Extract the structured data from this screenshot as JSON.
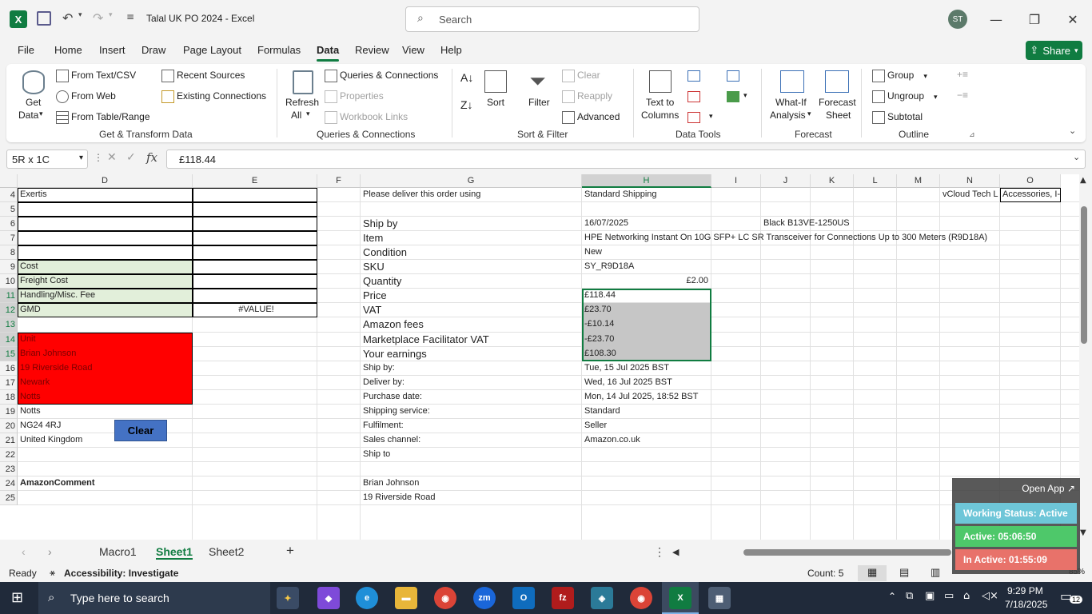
{
  "window": {
    "title": "Talal UK PO 2024  -  Excel",
    "search_placeholder": "Search",
    "user_initials": "ST"
  },
  "menu": [
    "File",
    "Home",
    "Insert",
    "Draw",
    "Page Layout",
    "Formulas",
    "Data",
    "Review",
    "View",
    "Help"
  ],
  "share_label": "Share",
  "ribbon": {
    "get_data": "Get",
    "get_data2": "Data",
    "from_text": "From Text/CSV",
    "from_web": "From Web",
    "from_table": "From Table/Range",
    "recent_sources": "Recent Sources",
    "existing_connections": "Existing Connections",
    "refresh": "Refresh",
    "refresh2": "All",
    "queries_connections": "Queries & Connections",
    "properties": "Properties",
    "workbook_links": "Workbook Links",
    "sort": "Sort",
    "filter": "Filter",
    "clear": "Clear",
    "reapply": "Reapply",
    "advanced": "Advanced",
    "text_to_columns": "Text to",
    "text_to_columns2": "Columns",
    "what_if": "What-If",
    "what_if2": "Analysis",
    "forecast_sheet": "Forecast",
    "forecast_sheet2": "Sheet",
    "group": "Group",
    "ungroup": "Ungroup",
    "subtotal": "Subtotal",
    "groups": {
      "get_transform": "Get & Transform Data",
      "queries": "Queries & Connections",
      "sort_filter": "Sort & Filter",
      "data_tools": "Data Tools",
      "forecast": "Forecast",
      "outline": "Outline"
    }
  },
  "name_box": "5R x 1C",
  "formula": "£118.44",
  "columns": [
    "D",
    "E",
    "F",
    "G",
    "H",
    "I",
    "J",
    "K",
    "L",
    "M",
    "N",
    "O"
  ],
  "rows": [
    "4",
    "5",
    "6",
    "7",
    "8",
    "9",
    "10",
    "11",
    "12",
    "13",
    "14",
    "15",
    "16",
    "17",
    "18",
    "19",
    "20",
    "21",
    "22",
    "23",
    "24",
    "25"
  ],
  "cells": {
    "D4": "Exertis",
    "D9": "Cost",
    "D10": "Freight Cost",
    "D11": "Handling/Misc. Fee",
    "D12": "GMD",
    "E12": "#VALUE!",
    "D14": "Unit",
    "D15": "Brian Johnson",
    "D16": "19 Riverside Road",
    "D17": "Newark",
    "D18": "Notts",
    "D19": "Notts",
    "D20": "NG24 4RJ",
    "D21": "United Kingdom",
    "D24": "AmazonComment",
    "G4": "Please deliver this order using",
    "H4": "Standard Shipping",
    "N4": "vCloud Tech L",
    "O4": "Accessories, I-",
    "G6": "Ship by",
    "H6": "16/07/2025",
    "J6": "Black B13VE-1250US",
    "G7": "Item",
    "H7": "HPE Networking Instant On 10G SFP+ LC SR Transceiver for Connections Up to 300 Meters (R9D18A)",
    "G8": "Condition",
    "H8": "New",
    "G9": "SKU",
    "H9": "SY_R9D18A",
    "G10": "Quantity",
    "H10": "£2.00",
    "G11": "Price",
    "H11": "£118.44",
    "G12": "VAT",
    "H12": "£23.70",
    "G13": "Amazon fees",
    "H13": "-£10.14",
    "G14": "Marketplace Facilitator VAT",
    "H14": "-£23.70",
    "G15": "Your earnings",
    "H15": "£108.30",
    "G16": "Ship by:",
    "H16": "Tue, 15 Jul 2025 BST",
    "G17": "Deliver by:",
    "H17": "Wed, 16 Jul 2025 BST",
    "G18": "Purchase date:",
    "H18": "Mon, 14 Jul 2025, 18:52 BST",
    "G19": "Shipping service:",
    "H19": "Standard",
    "G20": "Fulfilment:",
    "H20": "Seller",
    "G21": "Sales channel:",
    "H21": "Amazon.co.uk",
    "G22": "Ship to",
    "G24": "Brian Johnson",
    "G25": "19 Riverside Road"
  },
  "clear_button": "Clear",
  "sheets": [
    "Macro1",
    "Sheet1",
    "Sheet2"
  ],
  "status": {
    "ready": "Ready",
    "accessibility": "Accessibility: Investigate",
    "count": "Count: 5",
    "zoom": "85%"
  },
  "widget": {
    "open_app": "Open App",
    "working": "Working Status: Active",
    "active": "Active: 05:06:50",
    "inactive": "In Active: 01:55:09"
  },
  "taskbar": {
    "search": "Type here to search",
    "time": "9:29 PM",
    "date": "7/18/2025",
    "notif": "12"
  },
  "colors": {
    "excel_green": "#107c41",
    "red_fill": "#ff0000",
    "green_fill": "#e2efda",
    "selection_fill": "#c6c6c6",
    "clear_btn": "#4472c4"
  }
}
